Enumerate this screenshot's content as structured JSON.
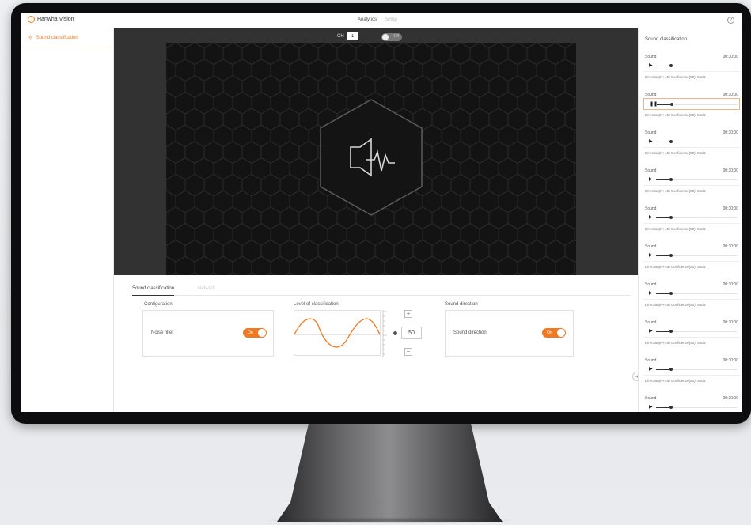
{
  "app": {
    "brand": "Hanwha Vision",
    "top_tabs": [
      "Analytics",
      "Setup"
    ],
    "help_glyph": "?"
  },
  "sidebar": {
    "items": [
      {
        "label": "Sound classification",
        "icon": "sound-classification-icon"
      }
    ]
  },
  "video": {
    "ch_label": "CH",
    "ch_value": "1",
    "toggle_text": "Off"
  },
  "bottom": {
    "tabs": [
      "Sound classification",
      "Network"
    ],
    "configuration": {
      "title": "Configuration",
      "noise_filter_label": "Noise filter",
      "noise_filter_state": "On"
    },
    "level": {
      "title": "Level of classification",
      "value": "50",
      "plus": "+",
      "minus": "−"
    },
    "direction": {
      "title": "Sound direction",
      "label": "Sound direction",
      "state": "On"
    }
  },
  "right_panel": {
    "title": "Sound classification",
    "items": [
      {
        "name": "Sound",
        "time": "00:30:00",
        "info": "Direction(N+45) Confidence(50): 50dB"
      },
      {
        "name": "Sound",
        "time": "00:30:00",
        "info": "Direction(N+45) Confidence(50): 50dB",
        "active": true
      },
      {
        "name": "Sound",
        "time": "00:30:00",
        "info": "Direction(N+45) Confidence(50): 50dB"
      },
      {
        "name": "Sound",
        "time": "00:30:00",
        "info": "Direction(N+45) Confidence(50): 50dB"
      },
      {
        "name": "Sound",
        "time": "00:30:00",
        "info": "Direction(N+45) Confidence(50): 50dB"
      },
      {
        "name": "Sound",
        "time": "00:30:00",
        "info": "Direction(N+45) Confidence(50): 50dB"
      },
      {
        "name": "Sound",
        "time": "00:30:00",
        "info": "Direction(N+45) Confidence(50): 50dB"
      },
      {
        "name": "Sound",
        "time": "00:30:00",
        "info": "Direction(N+45) Confidence(50): 50dB"
      },
      {
        "name": "Sound",
        "time": "00:30:00",
        "info": "Direction(N+45) Confidence(50): 50dB"
      },
      {
        "name": "Sound",
        "time": "00:30:00",
        "info": ""
      }
    ]
  },
  "colors": {
    "accent": "#f07a24",
    "video_bg": "#323232",
    "frame_bg": "#131313"
  }
}
